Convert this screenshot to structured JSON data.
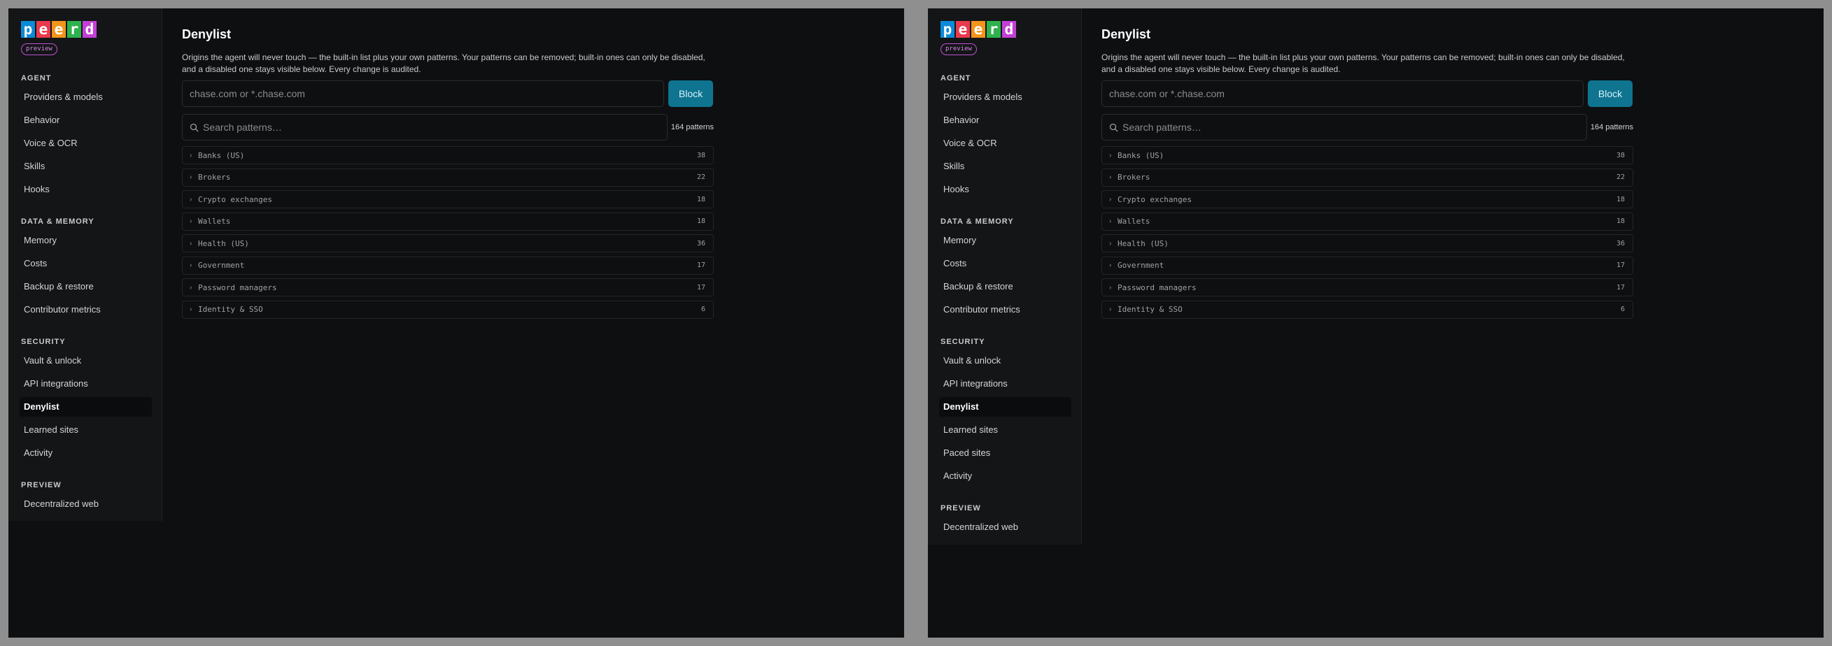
{
  "logo_letters": [
    "p",
    "e",
    "e",
    "r",
    "d"
  ],
  "logo_colors": [
    "#0b8ad8",
    "#e9394c",
    "#f2951b",
    "#2fb24e",
    "#c43fd6"
  ],
  "badge": "preview",
  "page_title": "Denylist",
  "description": "Origins the agent will never touch — the built-in list plus your own patterns. Your patterns can be removed; built-in ones can only be disabled, and a disabled one stays visible below. Every change is audited.",
  "pattern_input_placeholder": "chase.com or *.chase.com",
  "block_label": "Block",
  "search_placeholder": "Search patterns…",
  "pattern_count": "164 patterns",
  "groups": [
    {
      "name": "Banks (US)",
      "count": "38"
    },
    {
      "name": "Brokers",
      "count": "22"
    },
    {
      "name": "Crypto exchanges",
      "count": "18"
    },
    {
      "name": "Wallets",
      "count": "18"
    },
    {
      "name": "Health (US)",
      "count": "36"
    },
    {
      "name": "Government",
      "count": "17"
    },
    {
      "name": "Password managers",
      "count": "17"
    },
    {
      "name": "Identity & SSO",
      "count": "6"
    }
  ],
  "nav_left": [
    {
      "title": "AGENT",
      "items": [
        {
          "label": "Providers & models"
        },
        {
          "label": "Behavior"
        },
        {
          "label": "Voice & OCR"
        },
        {
          "label": "Skills"
        },
        {
          "label": "Hooks"
        }
      ]
    },
    {
      "title": "DATA & MEMORY",
      "items": [
        {
          "label": "Memory"
        },
        {
          "label": "Costs"
        },
        {
          "label": "Backup & restore"
        },
        {
          "label": "Contributor metrics"
        }
      ]
    },
    {
      "title": "SECURITY",
      "items": [
        {
          "label": "Vault & unlock"
        },
        {
          "label": "API integrations"
        },
        {
          "label": "Denylist",
          "active": true
        },
        {
          "label": "Learned sites"
        },
        {
          "label": "Activity"
        }
      ]
    },
    {
      "title": "PREVIEW",
      "items": [
        {
          "label": "Decentralized web"
        }
      ]
    }
  ],
  "nav_right": [
    {
      "title": "AGENT",
      "items": [
        {
          "label": "Providers & models"
        },
        {
          "label": "Behavior"
        },
        {
          "label": "Voice & OCR"
        },
        {
          "label": "Skills"
        },
        {
          "label": "Hooks"
        }
      ]
    },
    {
      "title": "DATA & MEMORY",
      "items": [
        {
          "label": "Memory"
        },
        {
          "label": "Costs"
        },
        {
          "label": "Backup & restore"
        },
        {
          "label": "Contributor metrics"
        }
      ]
    },
    {
      "title": "SECURITY",
      "items": [
        {
          "label": "Vault & unlock"
        },
        {
          "label": "API integrations"
        },
        {
          "label": "Denylist",
          "active": true
        },
        {
          "label": "Learned sites"
        },
        {
          "label": "Paced sites"
        },
        {
          "label": "Activity"
        }
      ]
    },
    {
      "title": "PREVIEW",
      "items": [
        {
          "label": "Decentralized web"
        }
      ]
    }
  ]
}
